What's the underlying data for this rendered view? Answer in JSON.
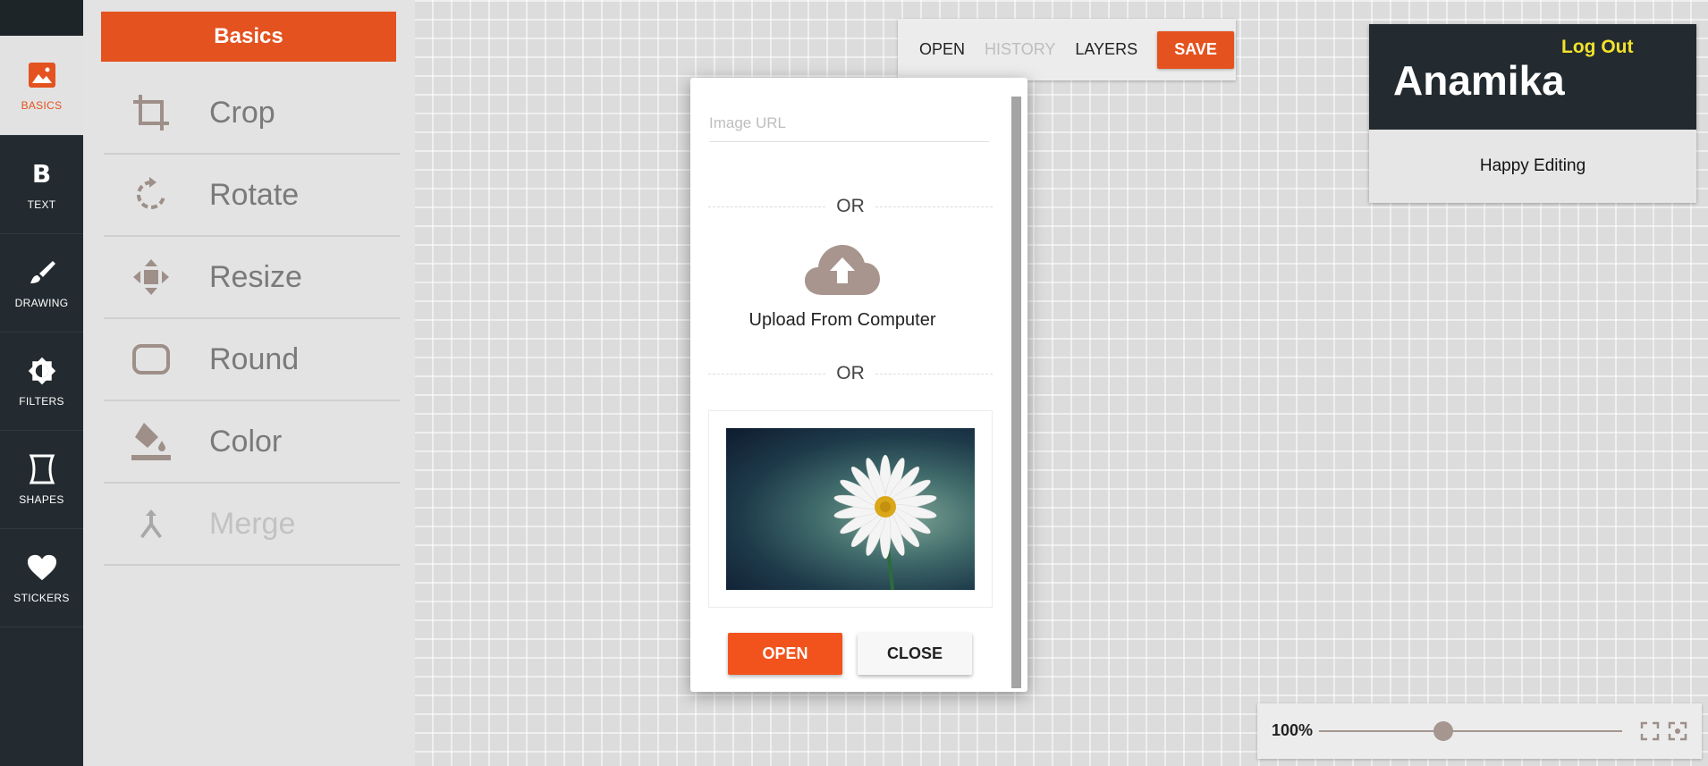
{
  "rail": {
    "items": [
      {
        "label": "BASICS",
        "icon": "image-icon"
      },
      {
        "label": "TEXT",
        "icon": "bold-icon",
        "glyph": "B"
      },
      {
        "label": "DRAWING",
        "icon": "brush-icon"
      },
      {
        "label": "FILTERS",
        "icon": "brightness-icon"
      },
      {
        "label": "SHAPES",
        "icon": "shape-icon"
      },
      {
        "label": "STICKERS",
        "icon": "heart-icon"
      }
    ]
  },
  "panel": {
    "title": "Basics",
    "tools": [
      {
        "label": "Crop",
        "icon": "crop-icon"
      },
      {
        "label": "Rotate",
        "icon": "rotate-icon"
      },
      {
        "label": "Resize",
        "icon": "move-icon"
      },
      {
        "label": "Round",
        "icon": "rounded-rect-icon"
      },
      {
        "label": "Color",
        "icon": "paint-bucket-icon"
      },
      {
        "label": "Merge",
        "icon": "merge-icon",
        "disabled": true
      }
    ]
  },
  "toolbar": {
    "open": "OPEN",
    "history": "HISTORY",
    "layers": "LAYERS",
    "save": "SAVE"
  },
  "user": {
    "logout": "Log Out",
    "name": "Anamika",
    "subtitle": "Happy Editing"
  },
  "modal": {
    "url_placeholder": "Image URL",
    "url_value": "",
    "or1": "OR",
    "upload": "Upload From Computer",
    "or2": "OR",
    "open": "OPEN",
    "close": "CLOSE"
  },
  "zoom": {
    "label": "100%",
    "level": 0.41
  },
  "colors": {
    "accent": "#e4521f",
    "rail_bg": "#232b30",
    "logout": "#f2e22c"
  }
}
